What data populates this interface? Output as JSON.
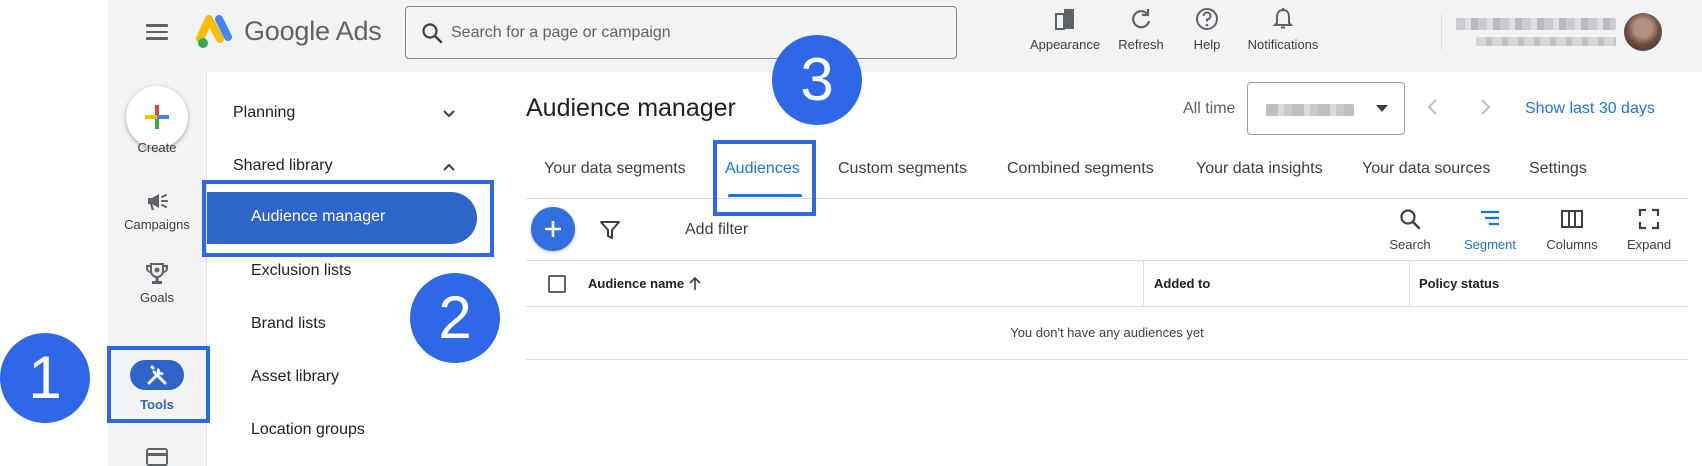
{
  "app": {
    "name": "Google Ads"
  },
  "search": {
    "placeholder": "Search for a page or campaign"
  },
  "top_actions": [
    {
      "label": "Appearance",
      "icon": "appearance-icon"
    },
    {
      "label": "Refresh",
      "icon": "refresh-icon"
    },
    {
      "label": "Help",
      "icon": "help-icon"
    },
    {
      "label": "Notifications",
      "icon": "bell-icon"
    }
  ],
  "rail": {
    "create_label": "Create",
    "items": [
      {
        "label": "Campaigns",
        "icon": "megaphone-icon"
      },
      {
        "label": "Goals",
        "icon": "trophy-icon"
      },
      {
        "label": "Tools",
        "icon": "tools-icon",
        "active": true
      }
    ]
  },
  "subnav": {
    "planning": "Planning",
    "shared_library": "Shared library",
    "items": [
      "Audience manager",
      "Exclusion lists",
      "Brand lists",
      "Asset library",
      "Location groups"
    ],
    "active_item": "Audience manager"
  },
  "main": {
    "title": "Audience manager",
    "date_range_label": "All time",
    "show_last": "Show last 30 days",
    "tabs": [
      "Your data segments",
      "Audiences",
      "Custom segments",
      "Combined segments",
      "Your data insights",
      "Your data sources",
      "Settings"
    ],
    "active_tab": "Audiences"
  },
  "toolbar": {
    "add_filter": "Add filter",
    "search_label": "Search",
    "segment_label": "Segment",
    "columns_label": "Columns",
    "expand_label": "Expand"
  },
  "table": {
    "columns": [
      "Audience name",
      "Added to",
      "Policy status"
    ],
    "empty_message": "You don't have any audiences yet"
  },
  "callouts": [
    "1",
    "2",
    "3"
  ],
  "colors": {
    "accent": "#1a73e8",
    "active_fill": "#2f64c9",
    "callout": "#2e68e6",
    "chrome": "#f1f3f4"
  }
}
